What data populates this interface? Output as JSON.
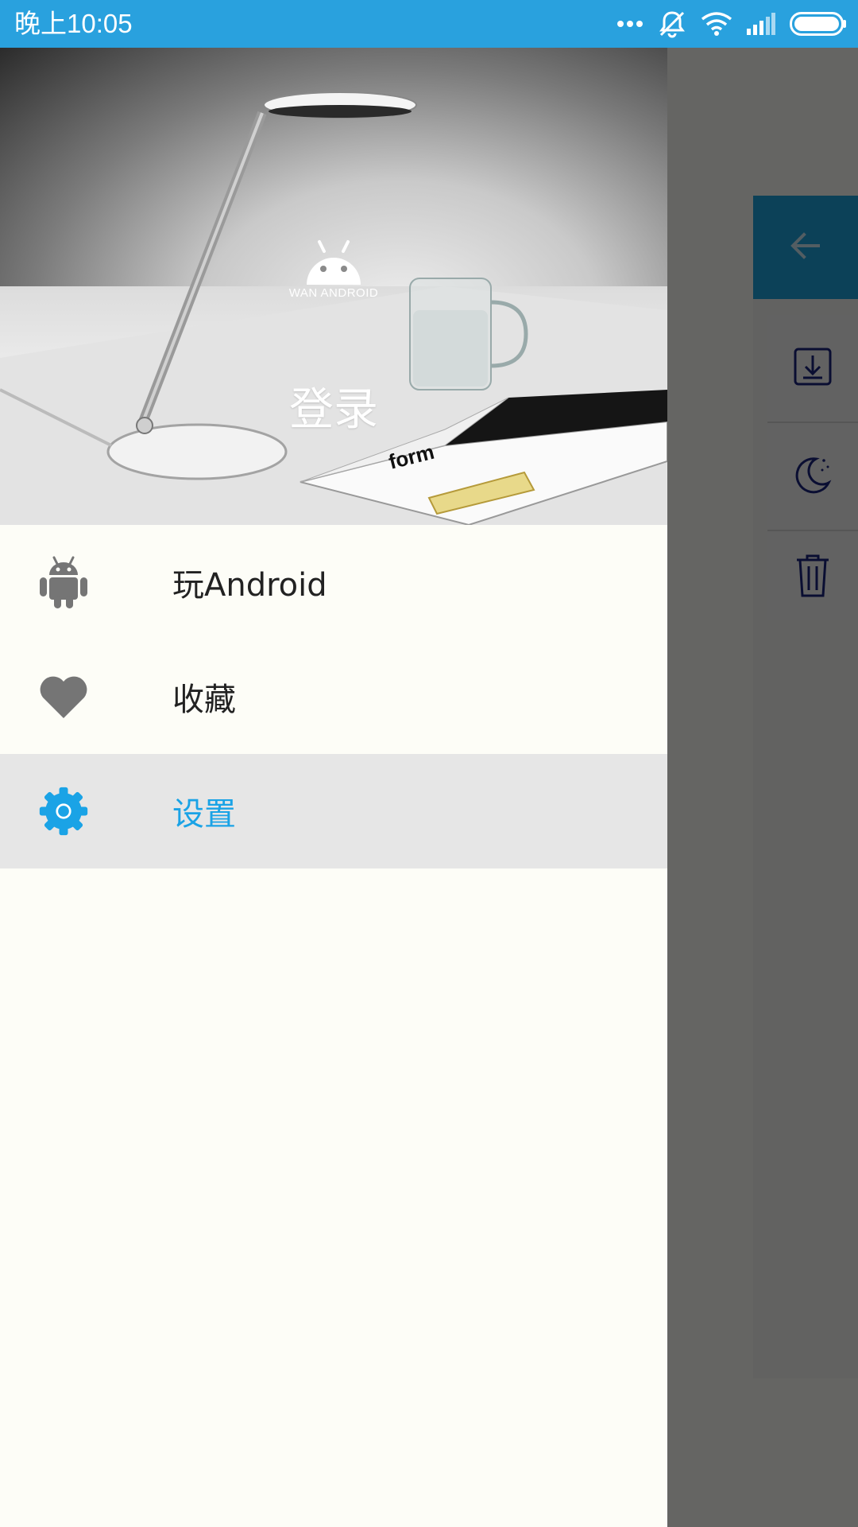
{
  "status_bar": {
    "time": "晚上10:05",
    "icons": [
      "more-dots-icon",
      "notifications-off-icon",
      "wifi-icon",
      "signal-icon",
      "battery-icon"
    ],
    "background_color": "#29a1de"
  },
  "drawer": {
    "header": {
      "logo_text": "WAN ANDROID",
      "login_label": "登录"
    },
    "menu": [
      {
        "icon": "android-icon",
        "label": "玩Android",
        "selected": false
      },
      {
        "icon": "heart-icon",
        "label": "收藏",
        "selected": false
      },
      {
        "icon": "settings-icon",
        "label": "设置",
        "selected": true
      }
    ]
  },
  "background_app": {
    "back_icon": "arrow-back-icon",
    "fab_actions": [
      "download-icon",
      "night-mode-icon",
      "delete-icon"
    ]
  },
  "colors": {
    "accent": "#1aa3e6",
    "menu_text": "#222222",
    "icon_gray": "#757575",
    "selected_bg": "#e6e6e6",
    "toolbar": "#1ea2dd"
  }
}
